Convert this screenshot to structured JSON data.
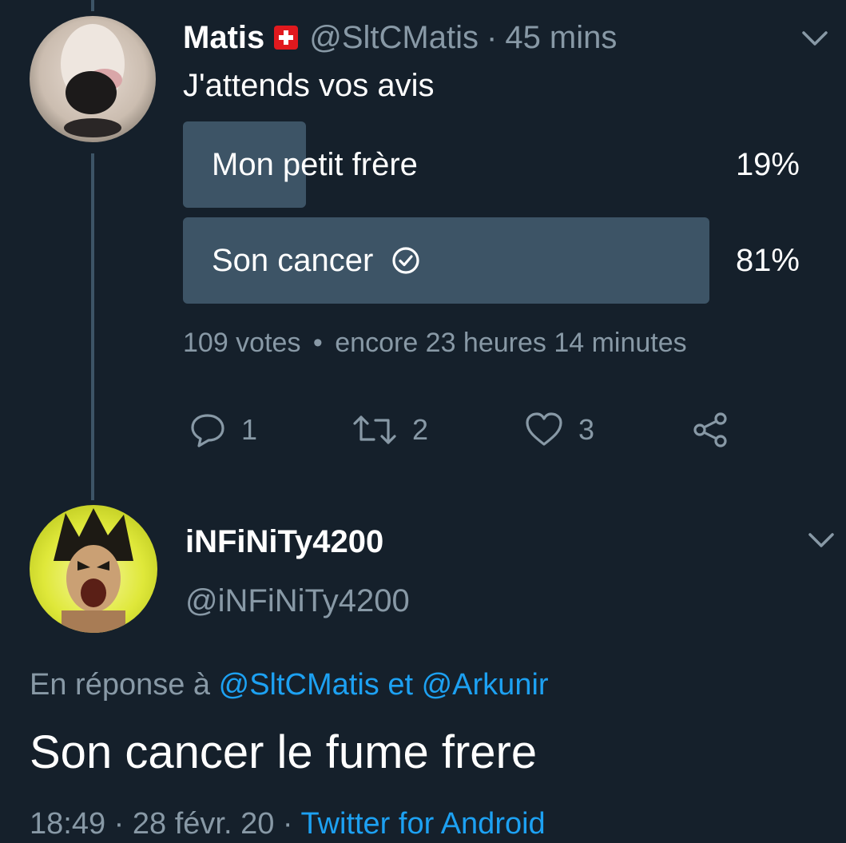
{
  "tweet": {
    "author_name": "Matis",
    "flag_icon": "swiss-flag-icon",
    "handle": "@SltCMatis",
    "separator": "·",
    "time": "45 mins",
    "text": "J'attends vos avis",
    "poll": {
      "options": [
        {
          "label": "Mon petit frère",
          "percent_label": "19%",
          "percent": 19,
          "selected": false
        },
        {
          "label": "Son cancer",
          "percent_label": "81%",
          "percent": 81,
          "selected": true
        }
      ],
      "votes": "109 votes",
      "dot": "•",
      "remaining": "encore 23 heures 14 minutes"
    },
    "actions": {
      "reply_count": "1",
      "retweet_count": "2",
      "like_count": "3"
    }
  },
  "reply": {
    "author_name": "iNFiNiTy4200",
    "handle": "@iNFiNiTy4200",
    "in_reply_prefix": "En réponse à",
    "mention_1": "@SltCMatis",
    "and_word": "et",
    "mention_2": "@Arkunir",
    "text": "Son cancer le fume frere",
    "time": "18:49",
    "sep1": "·",
    "date": "28 févr. 20",
    "sep2": "·",
    "source": "Twitter for Android"
  },
  "colors": {
    "background": "#15202b",
    "poll_bar": "#3d5466",
    "muted": "#8899a6",
    "link": "#1da1f2"
  }
}
